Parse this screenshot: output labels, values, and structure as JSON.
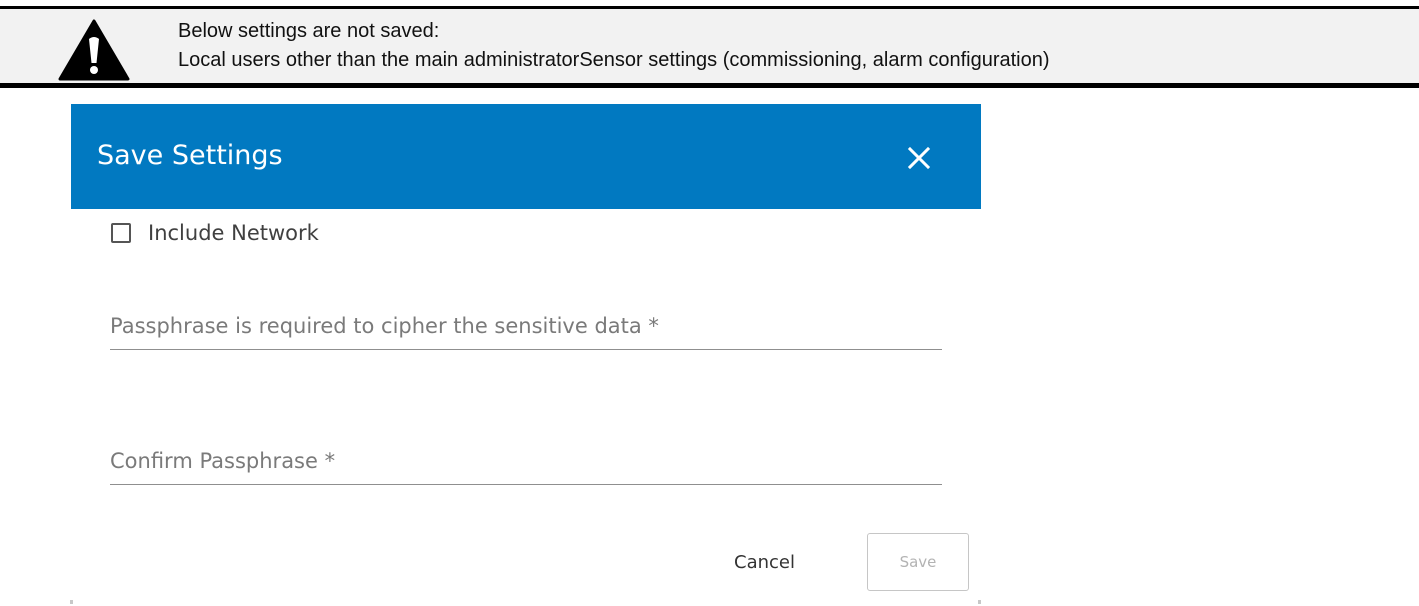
{
  "warning_banner": {
    "icon": "warning-triangle-icon",
    "title": "Below settings are not saved:",
    "items": "Local users other than the main administratorSensor settings (commissioning, alarm configuration)"
  },
  "dialog": {
    "title": "Save Settings",
    "close_icon": "close-icon",
    "include_network": {
      "label": "Include Network",
      "checked": false
    },
    "passphrase": {
      "placeholder": "Passphrase is required to cipher the sensitive data *",
      "value": ""
    },
    "confirm_passphrase": {
      "placeholder": "Confirm Passphrase *",
      "value": ""
    },
    "cancel_label": "Cancel",
    "save_label": "Save",
    "save_enabled": false
  },
  "colors": {
    "header_bg": "#0179c1",
    "banner_bg": "#f2f2f2",
    "banner_border": "#000000"
  }
}
